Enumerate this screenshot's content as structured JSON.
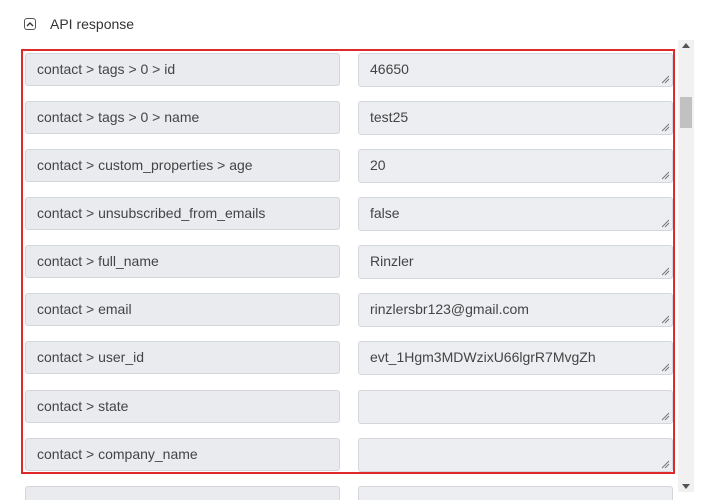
{
  "section": {
    "title": "API response"
  },
  "rows": [
    {
      "key": "contact > tags > 0 > id",
      "value": "46650"
    },
    {
      "key": "contact > tags > 0 > name",
      "value": "test25"
    },
    {
      "key": "contact > custom_properties > age",
      "value": "20"
    },
    {
      "key": "contact > unsubscribed_from_emails",
      "value": "false"
    },
    {
      "key": "contact > full_name",
      "value": "Rinzler"
    },
    {
      "key": "contact > email",
      "value": "rinzlersbr123@gmail.com"
    },
    {
      "key": "contact > user_id",
      "value": "evt_1Hgm3MDWzixU66lgrR7MvgZh"
    },
    {
      "key": "contact > state",
      "value": ""
    },
    {
      "key": "contact > company_name",
      "value": ""
    },
    {
      "key": "",
      "value": ""
    }
  ],
  "colors": {
    "highlight": "#e02a2a",
    "field_bg": "#e9ebee",
    "field_border": "#d3d6db"
  },
  "icons": {
    "collapse": "chevron-up-icon",
    "resize": "resize-grip-icon"
  }
}
